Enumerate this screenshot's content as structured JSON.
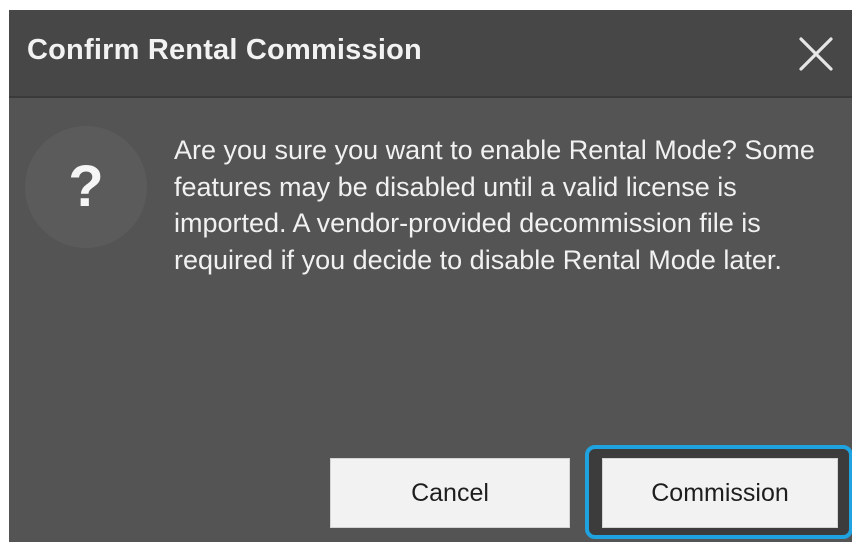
{
  "dialog": {
    "title": "Confirm Rental Commission",
    "close_icon": "close-icon",
    "status_icon": "question-mark-icon",
    "status_glyph": "?",
    "message": "Are you sure you want to enable Rental Mode? Some features may be disabled until a valid license is imported. A vendor-provided decommission file is required if you decide to disable Rental Mode later.",
    "buttons": {
      "cancel_label": "Cancel",
      "commission_label": "Commission"
    }
  },
  "colors": {
    "dialog_background": "#545454",
    "titlebar_background": "#474747",
    "button_background": "#f2f2f2",
    "focus_ring": "#1fa2e0"
  }
}
